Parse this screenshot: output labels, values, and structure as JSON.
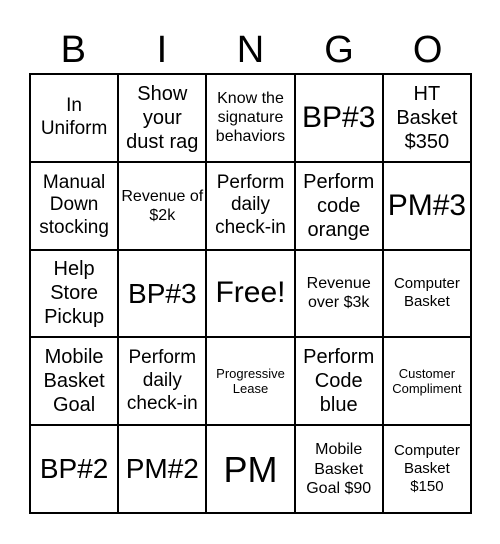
{
  "header": {
    "letters": [
      "B",
      "I",
      "N",
      "G",
      "O"
    ]
  },
  "cells": [
    "In Uniform",
    "Show your dust rag",
    "Know the signature behaviors",
    "BP#3",
    "HT Basket $350",
    "Manual Down stocking",
    "Revenue of $2k",
    "Perform daily check-in",
    "Perform code orange",
    "PM#3",
    "Help Store Pickup",
    "BP#3",
    "Free!",
    "Revenue over $3k",
    "Computer Basket",
    "Mobile Basket Goal",
    "Perform daily check-in",
    "Progressive Lease",
    "Perform Code blue",
    "Customer Compliment",
    "BP#2",
    "PM#2",
    "PM",
    "Mobile Basket Goal $90",
    "Computer Basket $150"
  ]
}
